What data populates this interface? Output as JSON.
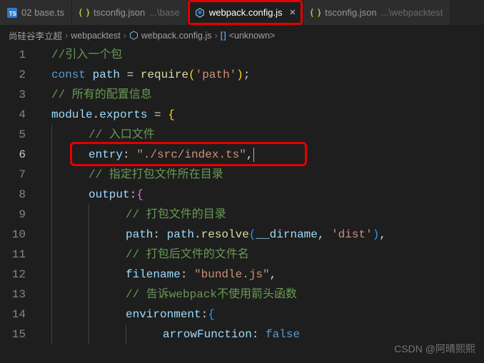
{
  "tabs": [
    {
      "icon": "ts",
      "label": "02 base.ts",
      "dir": "",
      "active": false
    },
    {
      "icon": "json",
      "label": "tsconfig.json",
      "dir": " ...\\base",
      "active": false
    },
    {
      "icon": "js",
      "label": "webpack.config.js",
      "dir": "",
      "active": true,
      "closable": true
    },
    {
      "icon": "json",
      "label": "tsconfig.json",
      "dir": " ...\\webpacktest",
      "active": false
    }
  ],
  "breadcrumb": {
    "root": "尚硅谷李立超",
    "folder": "webpacktest",
    "file": "webpack.config.js",
    "symbol": "<unknown>"
  },
  "code": {
    "lines": [
      {
        "n": 1,
        "indent": 0,
        "tokens": [
          [
            "comment",
            "//引入一个包"
          ]
        ]
      },
      {
        "n": 2,
        "indent": 0,
        "tokens": [
          [
            "keyword",
            "const "
          ],
          [
            "ident",
            "path"
          ],
          [
            "punc",
            " = "
          ],
          [
            "func",
            "require"
          ],
          [
            "bracey",
            "("
          ],
          [
            "string",
            "'path'"
          ],
          [
            "bracey",
            ")"
          ],
          [
            "punc",
            ";"
          ]
        ]
      },
      {
        "n": 3,
        "indent": 0,
        "tokens": [
          [
            "comment",
            "// 所有的配置信息"
          ]
        ]
      },
      {
        "n": 4,
        "indent": 0,
        "tokens": [
          [
            "ident",
            "module"
          ],
          [
            "punc",
            "."
          ],
          [
            "ident",
            "exports"
          ],
          [
            "punc",
            " = "
          ],
          [
            "bracey",
            "{"
          ]
        ]
      },
      {
        "n": 5,
        "indent": 1,
        "tokens": [
          [
            "comment",
            "// 入口文件"
          ]
        ]
      },
      {
        "n": 6,
        "indent": 1,
        "tokens": [
          [
            "prop",
            "entry"
          ],
          [
            "punc",
            ": "
          ],
          [
            "string",
            "\"./src/index.ts\""
          ],
          [
            "punc",
            ","
          ]
        ],
        "active": true,
        "cursor": true
      },
      {
        "n": 7,
        "indent": 1,
        "tokens": [
          [
            "comment",
            "// 指定打包文件所在目录"
          ]
        ]
      },
      {
        "n": 8,
        "indent": 1,
        "tokens": [
          [
            "prop",
            "output"
          ],
          [
            "punc",
            ":"
          ],
          [
            "bracep",
            "{"
          ]
        ]
      },
      {
        "n": 9,
        "indent": 2,
        "tokens": [
          [
            "comment",
            "// 打包文件的目录"
          ]
        ]
      },
      {
        "n": 10,
        "indent": 2,
        "tokens": [
          [
            "prop",
            "path"
          ],
          [
            "punc",
            ": "
          ],
          [
            "ident",
            "path"
          ],
          [
            "punc",
            "."
          ],
          [
            "func",
            "resolve"
          ],
          [
            "braceb",
            "("
          ],
          [
            "ident",
            "__dirname"
          ],
          [
            "punc",
            ", "
          ],
          [
            "string",
            "'dist'"
          ],
          [
            "braceb",
            ")"
          ],
          [
            "punc",
            ","
          ]
        ]
      },
      {
        "n": 11,
        "indent": 2,
        "tokens": [
          [
            "comment",
            "// 打包后文件的文件名"
          ]
        ]
      },
      {
        "n": 12,
        "indent": 2,
        "tokens": [
          [
            "prop",
            "filename"
          ],
          [
            "punc",
            ": "
          ],
          [
            "string",
            "\"bundle.js\""
          ],
          [
            "punc",
            ","
          ]
        ]
      },
      {
        "n": 13,
        "indent": 2,
        "tokens": [
          [
            "comment",
            "// 告诉webpack不使用箭头函数"
          ]
        ]
      },
      {
        "n": 14,
        "indent": 2,
        "tokens": [
          [
            "prop",
            "environment"
          ],
          [
            "punc",
            ":"
          ],
          [
            "braceb",
            "{"
          ]
        ]
      },
      {
        "n": 15,
        "indent": 3,
        "tokens": [
          [
            "prop",
            "arrowFunction"
          ],
          [
            "punc",
            ": "
          ],
          [
            "bool",
            "false"
          ]
        ]
      }
    ]
  },
  "watermark": "CSDN @阿晴熙熙",
  "colors": {
    "highlight": "#e60000",
    "bg": "#1e1e1e",
    "comment": "#6a9955",
    "keyword": "#569cd6",
    "string": "#ce9178",
    "function": "#dcdcaa",
    "identifier": "#9cdcfe"
  }
}
